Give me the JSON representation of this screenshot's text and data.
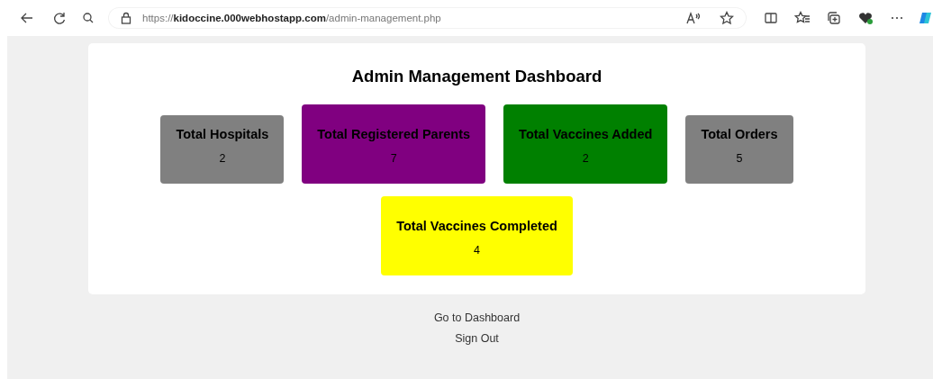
{
  "browser": {
    "url": "https://**kidoccine.000webhostapp.com**/admin-management.php"
  },
  "dashboard": {
    "title": "Admin Management Dashboard",
    "stat_rows": [
      [
        {
          "label": "Total Hospitals",
          "value": "2",
          "color": "#808080",
          "kind": "plain"
        },
        {
          "label": "Total Registered Parents",
          "value": "7",
          "color": "#800080",
          "kind": "large"
        },
        {
          "label": "Total Vaccines Added",
          "value": "2",
          "color": "#008000",
          "kind": "large"
        },
        {
          "label": "Total Orders",
          "value": "5",
          "color": "#808080",
          "kind": "plain"
        }
      ],
      [
        {
          "label": "Total Vaccines Completed",
          "value": "4",
          "color": "#ffff00",
          "kind": "large"
        }
      ]
    ]
  },
  "links": [
    "Go to Dashboard",
    "Sign Out"
  ]
}
